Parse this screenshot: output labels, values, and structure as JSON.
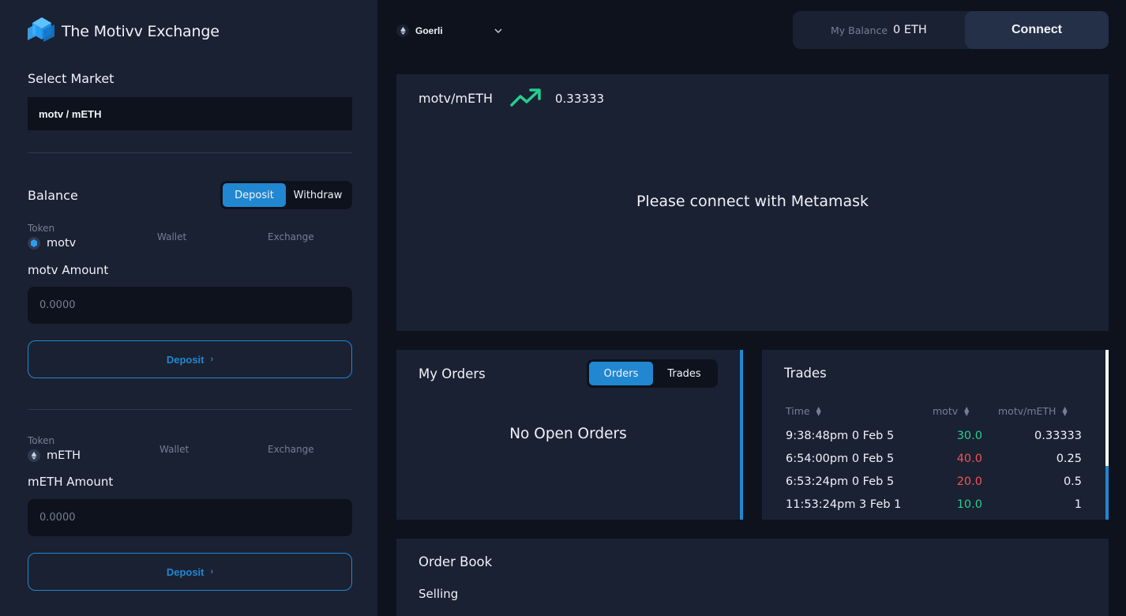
{
  "brand": {
    "title": "The Motivv Exchange"
  },
  "colors": {
    "accent": "#2187d0",
    "buy": "#25ce8f",
    "sell": "#f45353",
    "panel": "#1a2132",
    "background": "#0d121d",
    "muted": "#767f92"
  },
  "sidebar": {
    "select_market_label": "Select Market",
    "market_value": "motv / mETH",
    "balance_label": "Balance",
    "balance_tabs": [
      {
        "label": "Deposit",
        "active": true
      },
      {
        "label": "Withdraw",
        "active": false
      }
    ],
    "token1": {
      "token_header": "Token",
      "symbol": "motv",
      "wallet_header": "Wallet",
      "exchange_header": "Exchange",
      "amount_label": "motv Amount",
      "amount_placeholder": "0.0000",
      "button_label": "Deposit",
      "icon": "motv-token-icon"
    },
    "token2": {
      "token_header": "Token",
      "symbol": "mETH",
      "wallet_header": "Wallet",
      "exchange_header": "Exchange",
      "amount_label": "mETH Amount",
      "amount_placeholder": "0.0000",
      "button_label": "Deposit",
      "icon": "eth-icon"
    }
  },
  "header": {
    "network": "Goerli",
    "balance_label": "My Balance",
    "balance_value": "0 ETH",
    "connect_label": "Connect"
  },
  "chart": {
    "pair": "motv/mETH",
    "trend_icon": "trending-up-icon",
    "price": "0.33333",
    "message": "Please connect with Metamask"
  },
  "my_orders": {
    "title": "My Orders",
    "tabs": [
      {
        "label": "Orders",
        "active": true
      },
      {
        "label": "Trades",
        "active": false
      }
    ],
    "empty_message": "No Open Orders"
  },
  "trades": {
    "title": "Trades",
    "columns": [
      "Time",
      "motv",
      "motv/mETH"
    ],
    "rows": [
      {
        "time": "9:38:48pm 0 Feb 5",
        "amount": "30.0",
        "price": "0.33333",
        "side": "buy"
      },
      {
        "time": "6:54:00pm 0 Feb 5",
        "amount": "40.0",
        "price": "0.25",
        "side": "sell"
      },
      {
        "time": "6:53:24pm 0 Feb 5",
        "amount": "20.0",
        "price": "0.5",
        "side": "sell"
      },
      {
        "time": "11:53:24pm 3 Feb 1",
        "amount": "10.0",
        "price": "1",
        "side": "buy"
      }
    ]
  },
  "order_book": {
    "title": "Order Book",
    "selling_label": "Selling"
  }
}
